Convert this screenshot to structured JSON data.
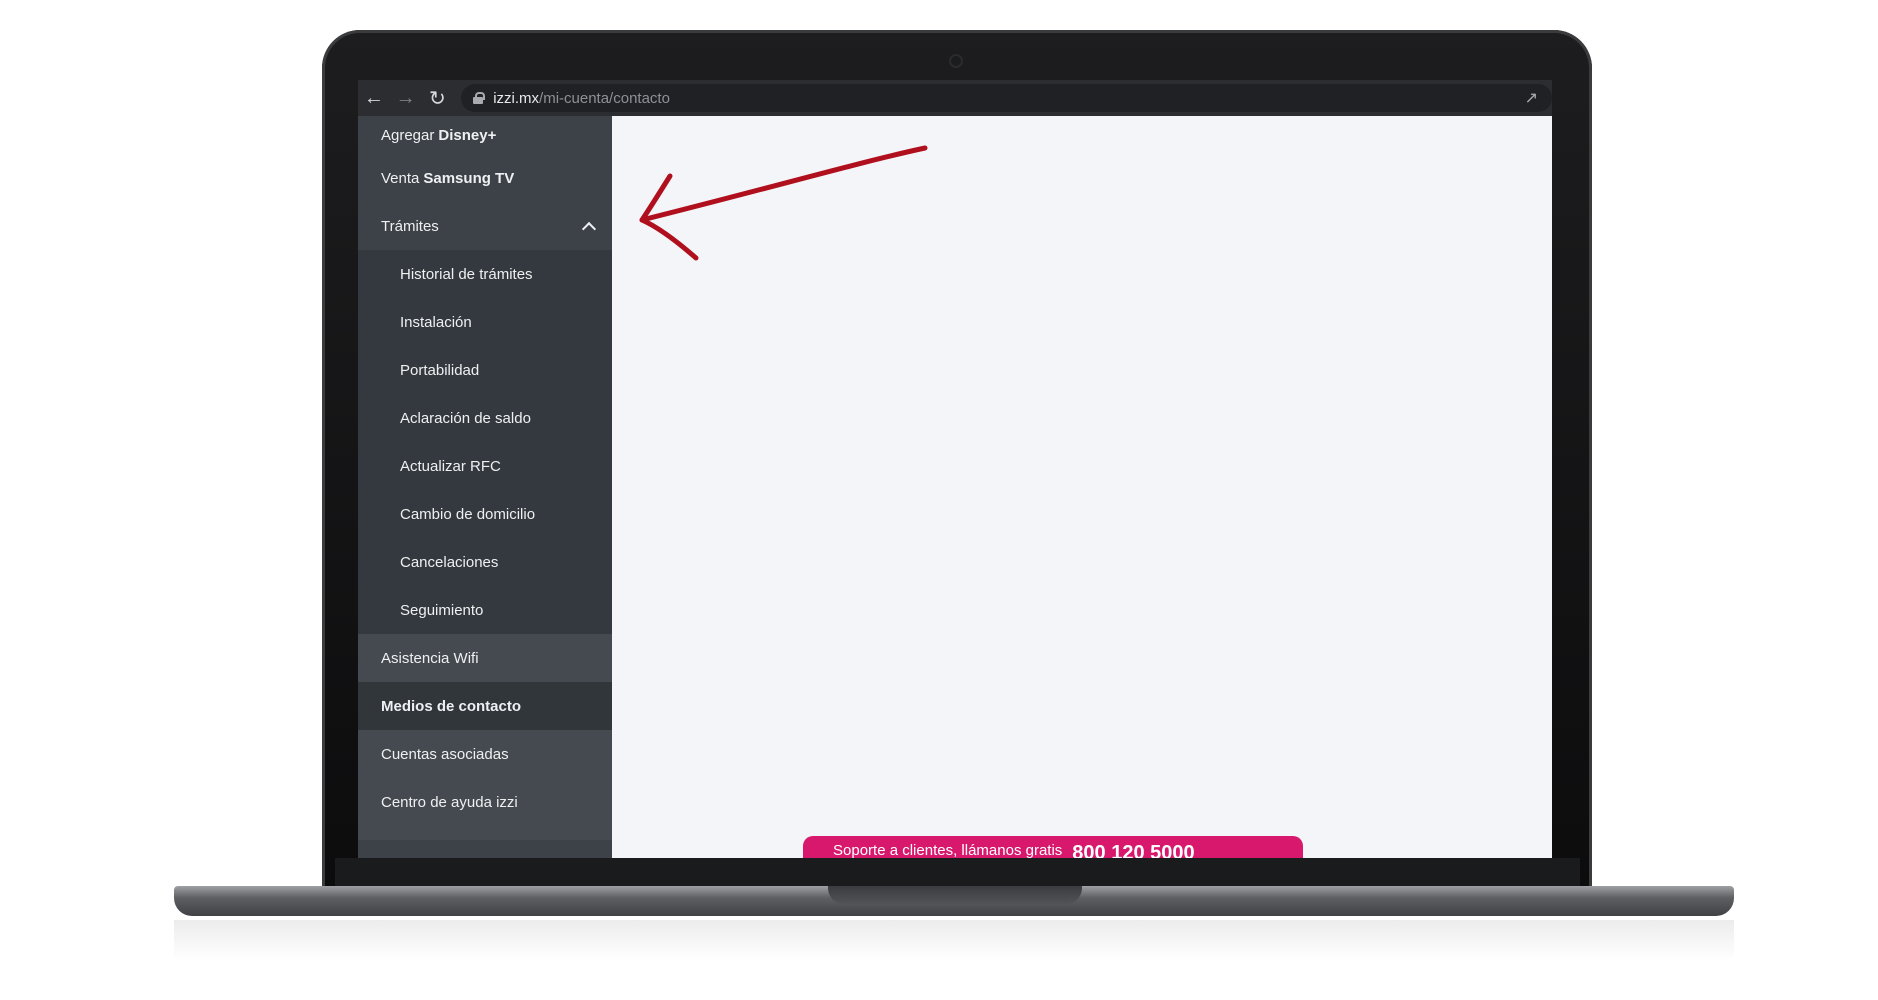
{
  "browser": {
    "url_host": "izzi.mx",
    "url_path": "/mi-cuenta/contacto"
  },
  "sidebar": {
    "top_items": [
      {
        "prefix": "Agregar",
        "bold": "Disney+"
      },
      {
        "prefix": "Venta",
        "bold": "Samsung TV"
      }
    ],
    "group_label": "Trámites",
    "sub_items": [
      "Historial de trámites",
      "Instalación",
      "Portabilidad",
      "Aclaración de saldo",
      "Actualizar RFC",
      "Cambio de domicilio",
      "Cancelaciones",
      "Seguimiento"
    ],
    "bottom_items": [
      "Asistencia Wifi",
      "Medios de contacto",
      "Cuentas asociadas",
      "Centro de ayuda izzi"
    ]
  },
  "support": {
    "label": "Soporte a clientes, llámanos gratis",
    "phone": "800 120 5000"
  },
  "colors": {
    "sidebar": "#3d4248",
    "accent": "#d8186c",
    "arrow": "#b0101e"
  }
}
